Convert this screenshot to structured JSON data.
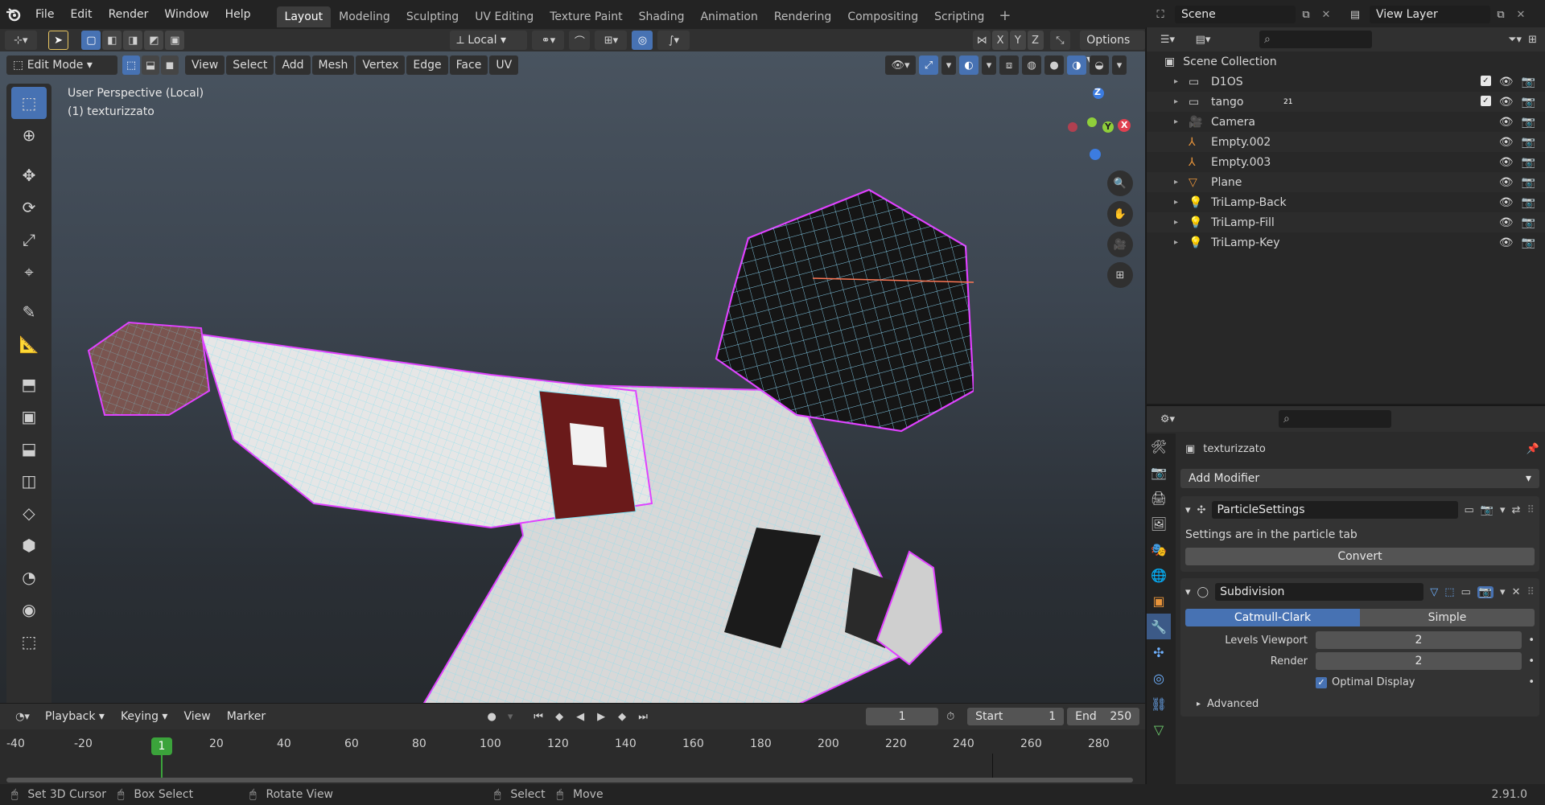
{
  "menu": [
    "File",
    "Edit",
    "Render",
    "Window",
    "Help"
  ],
  "workspaces": [
    "Layout",
    "Modeling",
    "Sculpting",
    "UV Editing",
    "Texture Paint",
    "Shading",
    "Animation",
    "Rendering",
    "Compositing",
    "Scripting"
  ],
  "active_workspace": "Layout",
  "scene_name": "Scene",
  "view_layer": "View Layer",
  "header": {
    "transform_orientation": "Local",
    "options_label": "Options",
    "axes": [
      "X",
      "Y",
      "Z"
    ]
  },
  "viewport_header": {
    "mode": "Edit Mode",
    "menus": [
      "View",
      "Select",
      "Add",
      "Mesh",
      "Vertex",
      "Edge",
      "Face",
      "UV"
    ]
  },
  "viewport": {
    "perspective": "User Perspective (Local)",
    "object": "(1) texturizzato",
    "gizmo_axes": [
      "Z",
      "Y",
      "X"
    ]
  },
  "timeline": {
    "menus": [
      "Playback",
      "Keying",
      "View",
      "Marker"
    ],
    "current_frame": "1",
    "start_label": "Start",
    "start": "1",
    "end_label": "End",
    "end": "250",
    "ticks": [
      "-40",
      "-20",
      "1",
      "20",
      "40",
      "60",
      "80",
      "100",
      "120",
      "140",
      "160",
      "180",
      "200",
      "220",
      "240",
      "260",
      "280"
    ]
  },
  "status": {
    "items": [
      "Set 3D Cursor",
      "Box Select",
      "Rotate View",
      "Select",
      "Move"
    ],
    "version": "2.91.0"
  },
  "outliner": {
    "root": "Scene Collection",
    "items": [
      {
        "name": "D1OS",
        "icon": "collection-icon"
      },
      {
        "name": "tango",
        "icon": "collection-icon",
        "badge": "21"
      },
      {
        "name": "Camera",
        "icon": "camera-icon"
      },
      {
        "name": "Empty.002",
        "icon": "empty-icon"
      },
      {
        "name": "Empty.003",
        "icon": "empty-icon"
      },
      {
        "name": "Plane",
        "icon": "mesh-icon"
      },
      {
        "name": "TriLamp-Back",
        "icon": "light-icon"
      },
      {
        "name": "TriLamp-Fill",
        "icon": "light-icon"
      },
      {
        "name": "TriLamp-Key",
        "icon": "light-icon"
      }
    ]
  },
  "properties": {
    "object_name": "texturizzato",
    "add_modifier": "Add Modifier",
    "particle": {
      "name": "ParticleSettings",
      "note": "Settings are in the particle tab",
      "convert": "Convert"
    },
    "subdivision": {
      "name": "Subdivision",
      "method_a": "Catmull-Clark",
      "method_b": "Simple",
      "levels_viewport_label": "Levels Viewport",
      "levels_viewport": "2",
      "render_label": "Render",
      "render": "2",
      "optimal_display": "Optimal Display",
      "advanced": "Advanced"
    }
  },
  "colors": {
    "accent": "#4772b3",
    "edit_select": "#ff33ff",
    "wire": "#7fe0f0",
    "frame_green": "#3ba33b"
  }
}
